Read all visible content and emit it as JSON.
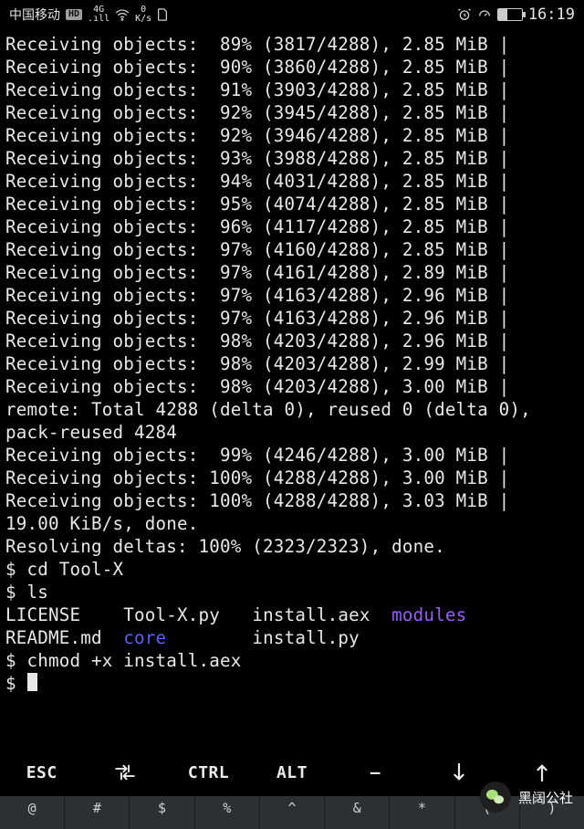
{
  "statusbar": {
    "carrier": "中国移动",
    "hd_badge": "HD",
    "net_label": "4G",
    "speed_value": "0",
    "speed_unit": "K/s",
    "time": "16:19",
    "battery_pct": 40
  },
  "terminal": {
    "receive_lines": [
      {
        "pct": "89%",
        "count": "(3817/4288)",
        "size": "2.85 MiB"
      },
      {
        "pct": "90%",
        "count": "(3860/4288)",
        "size": "2.85 MiB"
      },
      {
        "pct": "91%",
        "count": "(3903/4288)",
        "size": "2.85 MiB"
      },
      {
        "pct": "92%",
        "count": "(3945/4288)",
        "size": "2.85 MiB"
      },
      {
        "pct": "92%",
        "count": "(3946/4288)",
        "size": "2.85 MiB"
      },
      {
        "pct": "93%",
        "count": "(3988/4288)",
        "size": "2.85 MiB"
      },
      {
        "pct": "94%",
        "count": "(4031/4288)",
        "size": "2.85 MiB"
      },
      {
        "pct": "95%",
        "count": "(4074/4288)",
        "size": "2.85 MiB"
      },
      {
        "pct": "96%",
        "count": "(4117/4288)",
        "size": "2.85 MiB"
      },
      {
        "pct": "97%",
        "count": "(4160/4288)",
        "size": "2.85 MiB"
      },
      {
        "pct": "97%",
        "count": "(4161/4288)",
        "size": "2.89 MiB"
      },
      {
        "pct": "97%",
        "count": "(4163/4288)",
        "size": "2.96 MiB"
      },
      {
        "pct": "97%",
        "count": "(4163/4288)",
        "size": "2.96 MiB"
      },
      {
        "pct": "98%",
        "count": "(4203/4288)",
        "size": "2.96 MiB"
      },
      {
        "pct": "98%",
        "count": "(4203/4288)",
        "size": "2.99 MiB"
      },
      {
        "pct": "98%",
        "count": "(4203/4288)",
        "size": "3.00 MiB"
      }
    ],
    "remote_line": "remote: Total 4288 (delta 0), reused 0 (delta 0), pack-reused 4284",
    "receive_lines_2": [
      {
        "pct": "99%",
        "count": "(4246/4288)",
        "size": "3.00 MiB"
      },
      {
        "pct": "100%",
        "count": "(4288/4288)",
        "size": "3.00 MiB"
      },
      {
        "pct": "100%",
        "count": "(4288/4288)",
        "size": "3.03 MiB"
      }
    ],
    "done_line": "19.00 KiB/s, done.",
    "deltas_line": "Resolving deltas: 100% (2323/2323), done.",
    "prompt": "$",
    "cmd_cd": "cd Tool-X",
    "cmd_ls": "ls",
    "ls_output": {
      "row1": [
        "LICENSE",
        "Tool-X.py",
        "install.aex",
        "modules"
      ],
      "row2": [
        "README.md",
        "core",
        "install.py"
      ]
    },
    "cmd_chmod": "chmod +x install.aex",
    "receiving_label": "Receiving objects:",
    "pipe": " | "
  },
  "extrakeys": {
    "esc": "ESC",
    "ctrl": "CTRL",
    "alt": "ALT",
    "dash": "—",
    "tab_icon": "tab-icon",
    "down_icon": "arrow-down-icon",
    "up_icon": "arrow-up-icon"
  },
  "ime": {
    "keys": [
      "@",
      "#",
      "$",
      "%",
      "^",
      "&",
      "*",
      "(",
      ")"
    ]
  },
  "watermark": {
    "label": "黑阔公社"
  }
}
